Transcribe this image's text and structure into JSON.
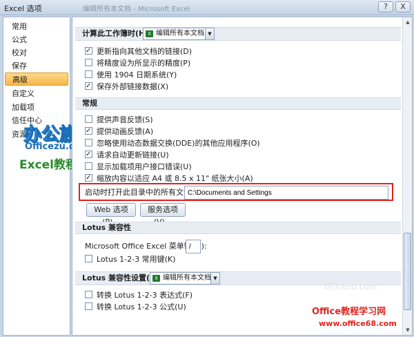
{
  "window": {
    "title": "Excel 选项",
    "blurred_title": "编辑所有本文档 - Microsoft Excel",
    "help_label": "?",
    "close_label": "X"
  },
  "sidebar": {
    "items": [
      {
        "label": "常用",
        "active": false
      },
      {
        "label": "公式",
        "active": false
      },
      {
        "label": "校对",
        "active": false
      },
      {
        "label": "保存",
        "active": false
      },
      {
        "label": "高级",
        "active": true
      },
      {
        "label": "自定义",
        "active": false
      },
      {
        "label": "加载项",
        "active": false
      },
      {
        "label": "信任中心",
        "active": false
      },
      {
        "label": "资源",
        "active": false
      }
    ]
  },
  "sections": {
    "calc": {
      "header": "计算此工作簿时(H):",
      "combo_value": "编辑所有本文档...",
      "options": [
        {
          "label": "更新指向其他文档的链接(D)",
          "checked": true
        },
        {
          "label": "将精度设为所显示的精度(P)",
          "checked": false
        },
        {
          "label": "使用 1904 日期系统(Y)",
          "checked": false
        },
        {
          "label": "保存外部链接数据(X)",
          "checked": true
        }
      ]
    },
    "general": {
      "header": "常规",
      "options": [
        {
          "label": "提供声音反馈(S)",
          "checked": false
        },
        {
          "label": "提供动画反馈(A)",
          "checked": true
        },
        {
          "label": "忽略使用动态数据交换(DDE)的其他应用程序(O)",
          "checked": false
        },
        {
          "label": "请求自动更新链接(U)",
          "checked": true
        },
        {
          "label": "显示加载项用户接口错误(U)",
          "checked": false
        },
        {
          "label": "缩放内容以适应 A4 或 8.5 x 11\" 纸张大小(A)",
          "checked": true
        }
      ],
      "startup_label": "启动时打开此目录中的所有文件(L):",
      "startup_value": "C:\\Documents and Settings",
      "web_options_button": "Web 选项(P)...",
      "service_options_button": "服务选项(V)..."
    },
    "lotus": {
      "header": "Lotus 兼容性",
      "menu_key_label": "Microsoft Office Excel 菜单键(M):",
      "menu_key_value": "/",
      "options": [
        {
          "label": "Lotus 1-2-3 常用键(K)",
          "checked": false
        }
      ]
    },
    "lotus_settings": {
      "header": "Lotus 兼容性设置(L):",
      "combo_value": "编辑所有本文档...",
      "options": [
        {
          "label": "转换 Lotus 1-2-3 表达式(F)",
          "checked": false
        },
        {
          "label": "转换 Lotus 1-2-3 公式(U)",
          "checked": false
        }
      ]
    }
  },
  "watermarks": {
    "logo_big": "办公族",
    "logo_site": "Officezu.com",
    "logo_tutorial": "Excel教程",
    "faint": "officezu.com",
    "site_cn": "Office教程学习网",
    "site_url": "www.office68.com"
  }
}
